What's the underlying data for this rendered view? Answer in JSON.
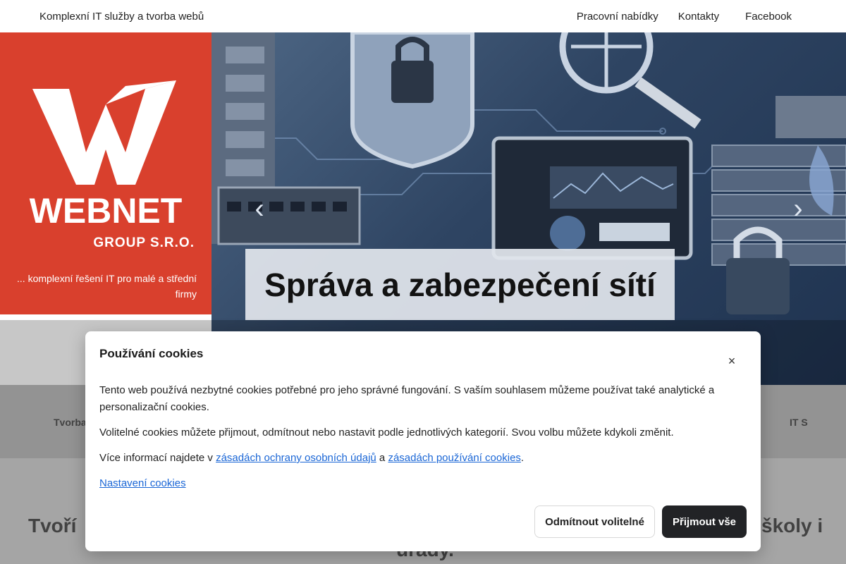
{
  "header": {
    "site_title": "Komplexní IT služby a tvorba webů",
    "nav": [
      "Pracovní nabídky",
      "Kontakty",
      "Facebook"
    ]
  },
  "brand": {
    "logo_text": "WEBNET",
    "logo_subtext": "GROUP S.R.O.",
    "tagline": "... komplexní řešení IT pro malé a střední firmy",
    "color": "#d9402d"
  },
  "hero": {
    "caption": "Správa a zabezpečení sítí",
    "prev_icon": "chevron-left-icon",
    "next_icon": "chevron-right-icon"
  },
  "background_partial": {
    "band_left": "Tvorba",
    "band_right": "IT S",
    "heading_left": "Tvoří",
    "heading_right": "školy i",
    "heading_line2": "úřady."
  },
  "cookie_dialog": {
    "title": "Používání cookies",
    "close_icon": "close-icon",
    "p1": "Tento web používá nezbytné cookies potřebné pro jeho správné fungování. S vaším souhlasem můžeme používat také analytické a personalizační cookies.",
    "p2": "Volitelné cookies můžete přijmout, odmítnout nebo nastavit podle jednotlivých kategorií. Svou volbu můžete kdykoli změnit.",
    "p3_prefix": "Více informací najdete v ",
    "p3_link1": "zásadách ochrany osobních údajů",
    "p3_mid": " a ",
    "p3_link2": "zásadách používání cookies",
    "p3_suffix": ".",
    "settings_link": "Nastavení cookies",
    "reject_label": "Odmítnout volitelné",
    "accept_label": "Přijmout vše"
  }
}
